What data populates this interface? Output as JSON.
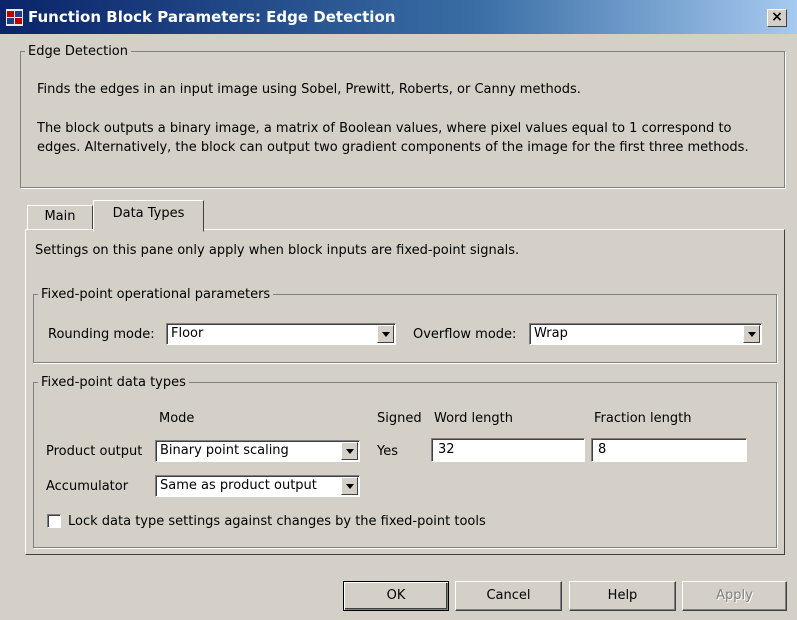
{
  "window": {
    "title": "Function Block Parameters: Edge Detection",
    "close_glyph": "×"
  },
  "block": {
    "group_label": "Edge Detection",
    "description_1": "Finds the edges in an input image using Sobel, Prewitt, Roberts, or Canny methods.",
    "description_2": "The block outputs a binary image, a matrix of Boolean values, where pixel values equal to 1 correspond to edges.  Alternatively, the block can output two gradient components of the image for the first three methods."
  },
  "tabs": [
    {
      "label": "Main",
      "active": false
    },
    {
      "label": "Data Types",
      "active": true
    }
  ],
  "panel": {
    "note": "Settings on this pane only apply when block inputs are fixed-point signals.",
    "operational": {
      "group_label": "Fixed-point operational parameters",
      "rounding_label": "Rounding mode:",
      "rounding_value": "Floor",
      "overflow_label": "Overflow mode:",
      "overflow_value": "Wrap"
    },
    "datatypes": {
      "group_label": "Fixed-point data types",
      "headers": {
        "mode": "Mode",
        "signed": "Signed",
        "word_length": "Word length",
        "fraction_length": "Fraction length"
      },
      "product_output": {
        "label": "Product output",
        "mode": "Binary point scaling",
        "signed": "Yes",
        "word_length": "32",
        "fraction_length": "8"
      },
      "accumulator": {
        "label": "Accumulator",
        "mode": "Same as product output"
      },
      "lock_label": "Lock data type settings against changes by the fixed-point tools",
      "lock_checked": false
    }
  },
  "buttons": {
    "ok": "OK",
    "cancel": "Cancel",
    "help": "Help",
    "apply": "Apply"
  },
  "colors": {
    "title_start": "#0a246a",
    "title_end": "#a6caf0",
    "face": "#d4d0c8"
  },
  "icons": {
    "app": "simulink-block-icon",
    "close": "close-icon",
    "dropdown": "chevron-down-icon"
  }
}
